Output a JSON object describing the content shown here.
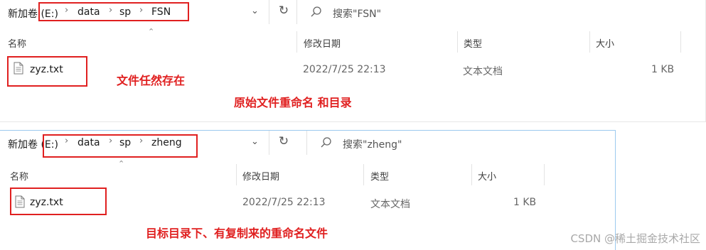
{
  "window1": {
    "drive": "新加卷 (E:)",
    "path": [
      "data",
      "sp",
      "FSN"
    ],
    "search_placeholder": "搜索\"FSN\"",
    "columns": {
      "name": "名称",
      "modified": "修改日期",
      "type": "类型",
      "size": "大小"
    },
    "file": {
      "name": "zyz.txt",
      "modified": "2022/7/25 22:13",
      "type": "文本文档",
      "size": "1 KB"
    },
    "annotations": {
      "file_note": "文件任然存在",
      "rename_note": "原始文件重命名 和目录"
    }
  },
  "window2": {
    "drive": "新加卷 (E:)",
    "path": [
      "data",
      "sp",
      "zheng"
    ],
    "search_placeholder": "搜索\"zheng\"",
    "columns": {
      "name": "名称",
      "modified": "修改日期",
      "type": "类型",
      "size": "大小"
    },
    "file": {
      "name": "zyz.txt",
      "modified": "2022/7/25 22:13",
      "type": "文本文档",
      "size": "1 KB"
    },
    "annotations": {
      "target_note": "目标目录下、有复制来的重命名文件"
    }
  },
  "watermark": "CSDN @稀土掘金技术社区",
  "colors": {
    "annotation_red": "#e02020",
    "focus_border": "#9cc9ee"
  },
  "icons": {
    "separator": "chevron-right-icon",
    "dropdown": "chevron-down-icon",
    "refresh": "refresh-icon",
    "search": "search-icon",
    "file": "text-file-icon"
  }
}
